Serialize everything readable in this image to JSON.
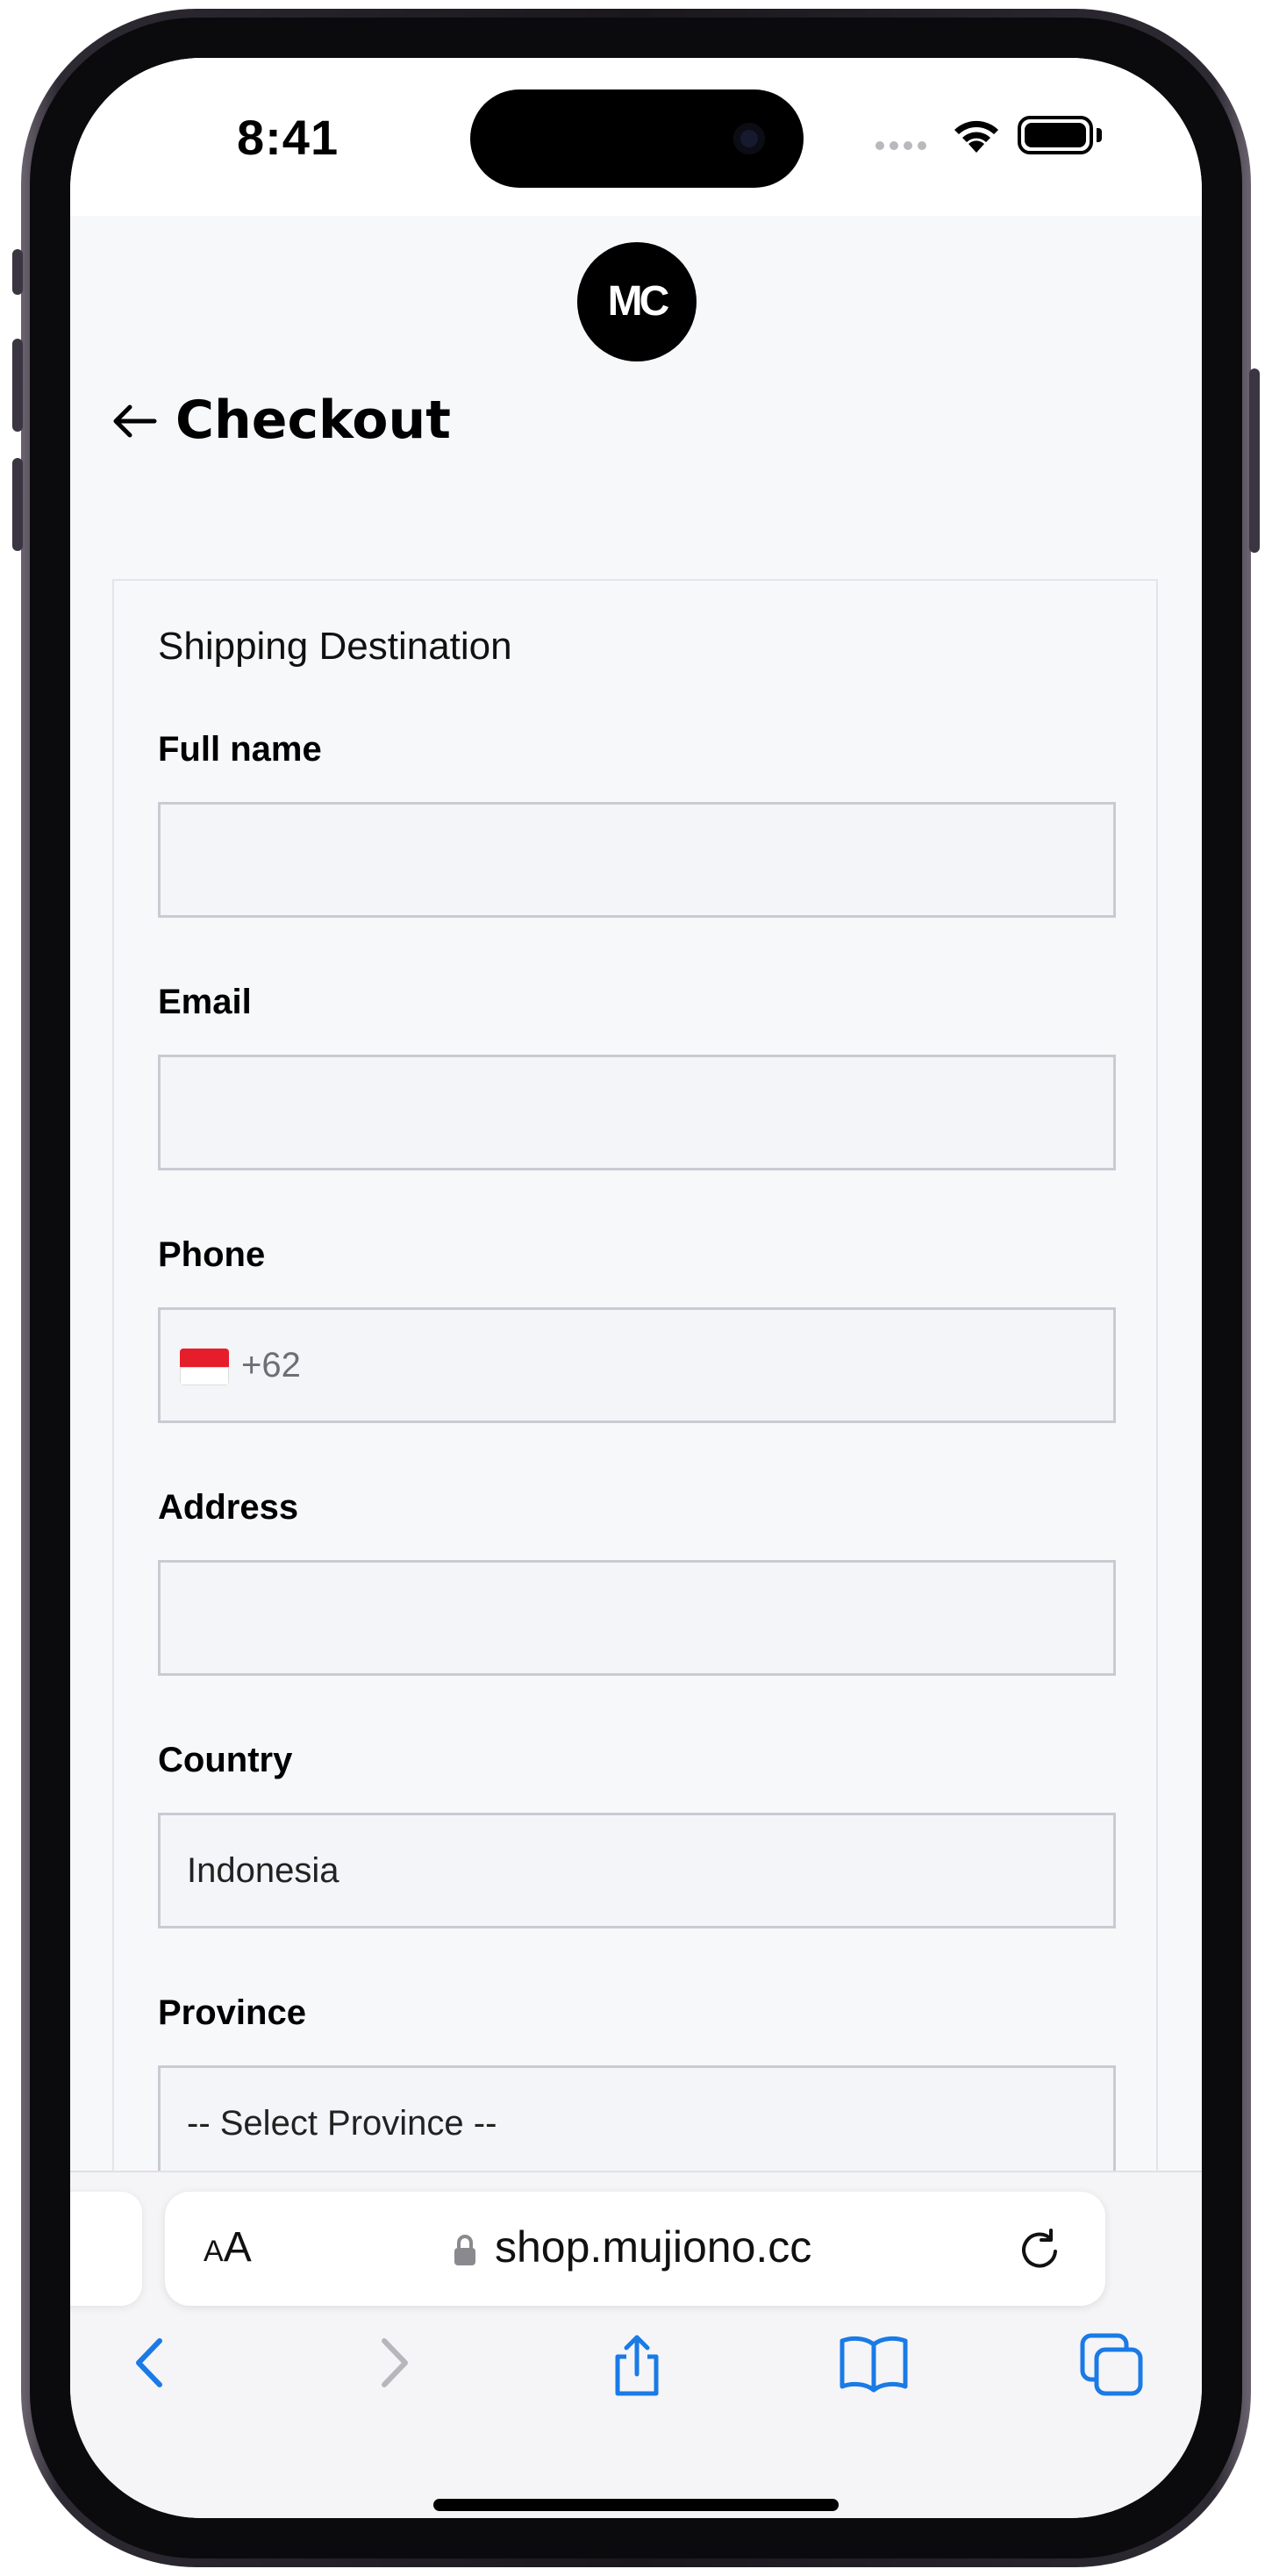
{
  "status_bar": {
    "time": "8:41"
  },
  "header": {
    "logo_text": "MC",
    "title": "Checkout"
  },
  "form": {
    "section_title": "Shipping Destination",
    "fields": [
      {
        "label": "Full name",
        "value": ""
      },
      {
        "label": "Email",
        "value": ""
      },
      {
        "label": "Phone",
        "prefix": "+62",
        "flag": "indonesia-flag-icon"
      },
      {
        "label": "Address",
        "value": ""
      },
      {
        "label": "Country",
        "value": "Indonesia"
      },
      {
        "label": "Province",
        "value": "-- Select Province --"
      }
    ]
  },
  "safari": {
    "text_size_button": "AA",
    "url": "shop.mujiono.cc",
    "icons": [
      "lock-icon",
      "reload-icon",
      "back-icon",
      "forward-icon",
      "share-icon",
      "bookmarks-icon",
      "tabs-icon"
    ]
  },
  "colors": {
    "accent": "#1a7ae6",
    "page_bg": "#f7f8fa",
    "field_border": "#c8cbd2"
  }
}
